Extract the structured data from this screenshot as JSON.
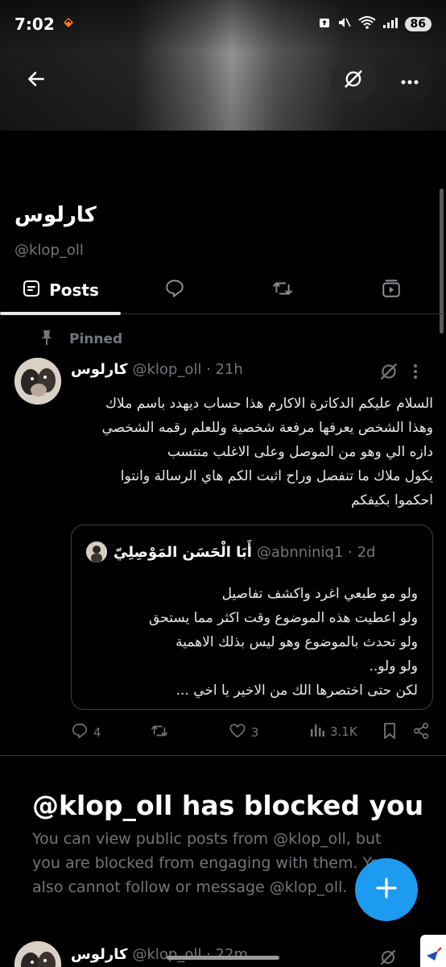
{
  "status_bar": {
    "time": "7:02",
    "battery": "86"
  },
  "header": {
    "back_icon": "arrow-left-icon",
    "grok_icon": "grok-icon",
    "more_icon": "more-horizontal-icon"
  },
  "profile": {
    "display_name": "كارلوس",
    "handle": "@klop_oll"
  },
  "tabs": [
    {
      "label": "Posts",
      "icon": "posts-icon",
      "selected": true
    },
    {
      "label": "",
      "icon": "reply-icon",
      "selected": false
    },
    {
      "label": "",
      "icon": "repost-icon",
      "selected": false
    },
    {
      "label": "",
      "icon": "media-icon",
      "selected": false
    }
  ],
  "pinned_post": {
    "pinned_label": "Pinned",
    "author_name": "كارلوس",
    "author_meta": "@klop_oll · 21h",
    "body_lines": [
      "السلام عليكم الدكاترة الاكارم هذا حساب ديهدد باسم ملاك",
      "وهذا الشخص يعرفها مرفعة شخصية وللعلم رقمه الشخصي",
      "دازه الي وهو من الموصل وعلى الاغلب منتسب",
      "يكول ملاك ما تنفصل وراح اثبت الكم هاي الرسالة وانتوا",
      "احكموا بكيفكم"
    ],
    "quote": {
      "author_name": "أَبَا الْحَسَن المَوْصِلِيّ",
      "author_meta": "@abnniniq1 · 2d",
      "body_lines": [
        "ولو مو طبعي اغرد واكشف تفاصيل",
        "ولو اعطيت هذه الموضوع وقت اكثر مما يستحق",
        "ولو تحدث بالموضوع وهو ليس بذلك الاهمية",
        "ولو ولو..",
        "لكن حتى اختصرها الك من الاخير يا اخي ..."
      ]
    },
    "actions": {
      "replies": "4",
      "reposts": "",
      "likes": "3",
      "views": "3.1K"
    }
  },
  "blocked_notice": {
    "title": "@klop_oll has blocked you",
    "description": "You can view public posts from @klop_oll, but you are blocked from engaging with them. You also cannot follow or message @klop_oll."
  },
  "second_post": {
    "author_name": "كارلوس",
    "author_meta": "@klop_oll · 22m"
  },
  "fab": {
    "icon": "plus-icon"
  },
  "colors": {
    "accent": "#1d9bf0",
    "background": "#000000",
    "muted_text": "#71767b",
    "divider": "#2f3336"
  }
}
